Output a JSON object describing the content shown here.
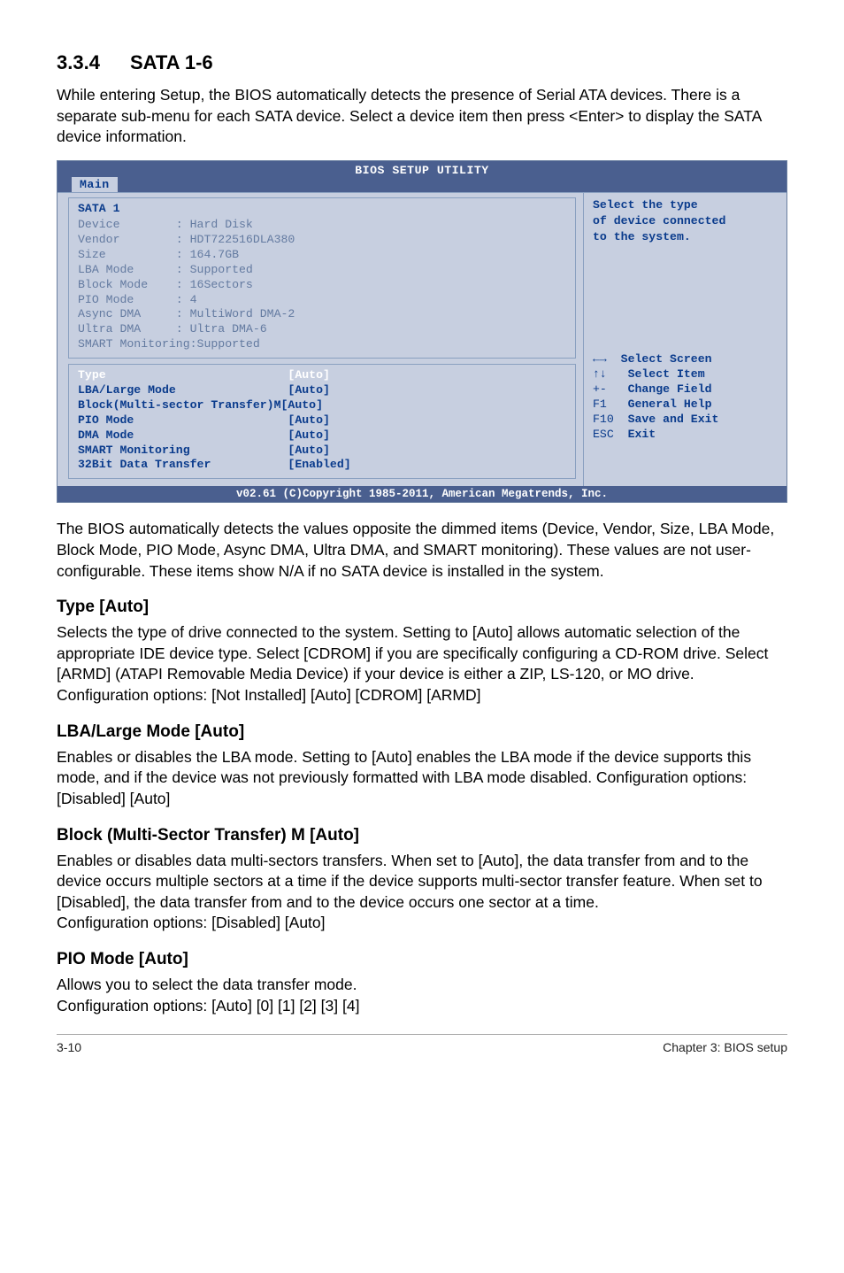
{
  "heading": {
    "num": "3.3.4",
    "title": "SATA 1-6"
  },
  "intro": "While entering Setup, the BIOS automatically detects the presence of Serial ATA devices. There is a separate sub-menu for each SATA device. Select a device item then press <Enter> to display the SATA device information.",
  "bios": {
    "util_title": "BIOS SETUP UTILITY",
    "tab": "Main",
    "panel_title": "SATA 1",
    "info_rows": [
      {
        "label": "Device",
        "value": ": Hard Disk"
      },
      {
        "label": "Vendor",
        "value": ": HDT722516DLA380"
      },
      {
        "label": "Size",
        "value": ": 164.7GB"
      },
      {
        "label": "LBA Mode",
        "value": ": Supported"
      },
      {
        "label": "Block Mode",
        "value": ": 16Sectors"
      },
      {
        "label": "PIO Mode",
        "value": ": 4"
      },
      {
        "label": "Async DMA",
        "value": ": MultiWord DMA-2"
      },
      {
        "label": "Ultra DMA",
        "value": ": Ultra DMA-6"
      },
      {
        "label": "SMART Monitoring",
        "value": ":Supported",
        "nocolpad": true
      }
    ],
    "opt_rows": [
      {
        "label": "Type",
        "value": "[Auto]",
        "hl": true
      },
      {
        "label": "LBA/Large Mode",
        "value": "[Auto]"
      },
      {
        "label": "Block(Multi-sector Transfer)M",
        "value": "[Auto]",
        "tight": true
      },
      {
        "label": "PIO Mode",
        "value": "[Auto]"
      },
      {
        "label": "DMA Mode",
        "value": "[Auto]"
      },
      {
        "label": "SMART Monitoring",
        "value": "[Auto]"
      },
      {
        "label": "32Bit Data Transfer",
        "value": "[Enabled]"
      }
    ],
    "hint1": "Select the type",
    "hint2": "of device connected",
    "hint3": "to the system.",
    "nav": [
      {
        "k": "←→ ",
        "t": "Select Screen"
      },
      {
        "k": "↑↓  ",
        "t": "Select Item"
      },
      {
        "k": "+-  ",
        "t": "Change Field"
      },
      {
        "k": "F1  ",
        "t": "General Help"
      },
      {
        "k": "F10 ",
        "t": "Save and Exit"
      },
      {
        "k": "ESC ",
        "t": "Exit"
      }
    ],
    "footer": "v02.61 (C)Copyright 1985-2011, American Megatrends, Inc."
  },
  "para2": "The BIOS automatically detects the values opposite the dimmed items (Device, Vendor, Size, LBA Mode, Block Mode, PIO Mode, Async DMA, Ultra DMA, and SMART monitoring). These values are not user-configurable. These items show N/A if no SATA device is installed in the system.",
  "sections": [
    {
      "h": "Type [Auto]",
      "p": "Selects the type of drive connected to the system. Setting to [Auto] allows automatic selection of the appropriate IDE device type. Select [CDROM] if you are specifically configuring a CD-ROM drive. Select [ARMD] (ATAPI Removable Media Device) if your device is either a ZIP, LS-120, or MO drive.\nConfiguration options: [Not Installed] [Auto] [CDROM] [ARMD]"
    },
    {
      "h": "LBA/Large Mode [Auto]",
      "p": "Enables or disables the LBA mode. Setting to [Auto] enables the LBA mode if the device supports this mode, and if the device was not previously formatted with LBA mode disabled. Configuration options: [Disabled] [Auto]"
    },
    {
      "h": "Block (Multi-Sector Transfer) M [Auto]",
      "p": "Enables or disables data multi-sectors transfers. When set to [Auto], the data transfer from and to the device occurs multiple sectors at a time if the device supports multi-sector transfer feature. When set to [Disabled], the data transfer from and to the device occurs one sector at a time.\nConfiguration options: [Disabled] [Auto]"
    },
    {
      "h": "PIO Mode [Auto]",
      "p": "Allows you to select the data transfer mode.\nConfiguration options: [Auto] [0] [1] [2] [3] [4]"
    }
  ],
  "footer": {
    "left": "3-10",
    "right": "Chapter 3: BIOS setup"
  }
}
